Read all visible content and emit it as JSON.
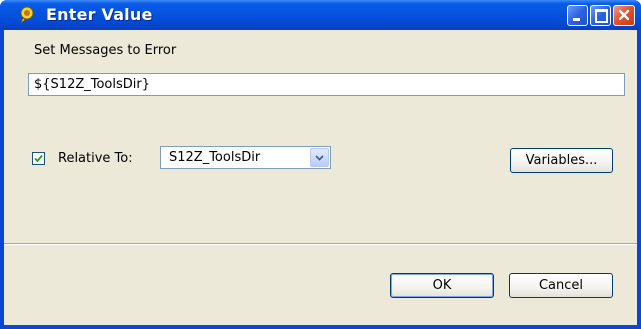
{
  "window": {
    "title": "Enter Value",
    "accent_color": "#0553e0",
    "close_color": "#e2542f"
  },
  "dialog": {
    "prompt_label": "Set Messages to Error",
    "value": "${S12Z_ToolsDir}",
    "relative_checkbox_checked": true,
    "relative_label": "Relative To:",
    "relative_select_value": "S12Z_ToolsDir",
    "variables_button": "Variables...",
    "ok_button": "OK",
    "cancel_button": "Cancel"
  },
  "icons": [
    "app-icon",
    "minimize-icon",
    "maximize-icon",
    "close-icon",
    "checkmark-icon",
    "chevron-down-icon"
  ]
}
